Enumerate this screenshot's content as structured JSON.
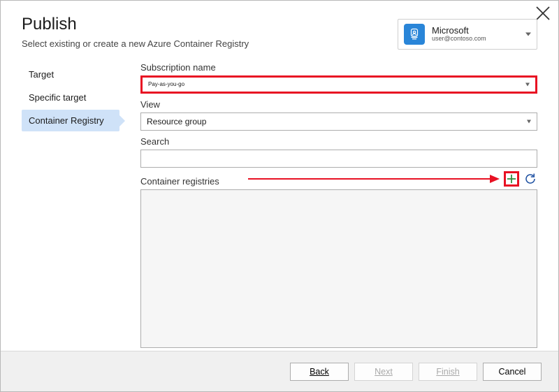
{
  "title": "Publish",
  "subtitle": "Select existing or create a new Azure Container Registry",
  "account": {
    "name": "Microsoft",
    "email": "user@contoso.com"
  },
  "sidebar": {
    "items": [
      {
        "label": "Target"
      },
      {
        "label": "Specific target"
      },
      {
        "label": "Container Registry"
      }
    ]
  },
  "fields": {
    "subscription_label": "Subscription name",
    "subscription_value": "Pay-as-you-go",
    "view_label": "View",
    "view_value": "Resource group",
    "search_label": "Search",
    "search_value": "",
    "registries_label": "Container registries"
  },
  "footer": {
    "back": "Back",
    "next": "Next",
    "finish": "Finish",
    "cancel": "Cancel"
  }
}
